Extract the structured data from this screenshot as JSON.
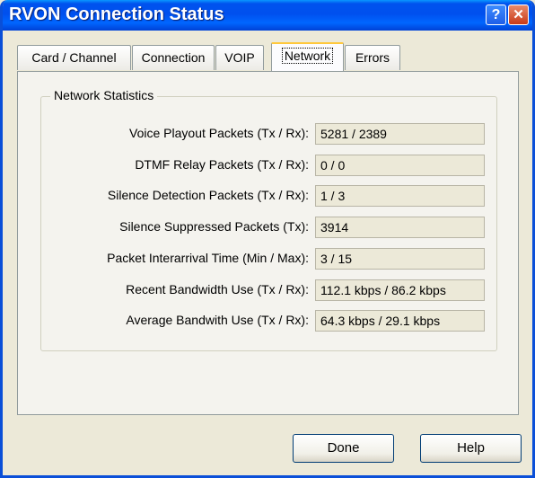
{
  "window": {
    "title": "RVON Connection Status",
    "help_glyph": "?",
    "close_glyph": "✕"
  },
  "tabs": [
    {
      "label": "Card / Channel",
      "active": false
    },
    {
      "label": "Connection",
      "active": false
    },
    {
      "label": "VOIP",
      "active": false
    },
    {
      "label": "Network",
      "active": true
    },
    {
      "label": "Errors",
      "active": false
    }
  ],
  "group": {
    "label": "Network Statistics",
    "rows": [
      {
        "label": "Voice Playout Packets (Tx / Rx):",
        "value": "5281 / 2389"
      },
      {
        "label": "DTMF Relay Packets (Tx / Rx):",
        "value": "0 / 0"
      },
      {
        "label": "Silence Detection Packets (Tx / Rx):",
        "value": "1 / 3"
      },
      {
        "label": "Silence Suppressed Packets (Tx):",
        "value": "3914"
      },
      {
        "label": "Packet Interarrival Time (Min / Max):",
        "value": "3 / 15"
      },
      {
        "label": "Recent Bandwidth Use (Tx / Rx):",
        "value": "112.1 kbps / 86.2 kbps"
      },
      {
        "label": "Average Bandwith Use (Tx / Rx):",
        "value": "64.3 kbps / 29.1 kbps"
      }
    ]
  },
  "buttons": {
    "done": "Done",
    "help": "Help"
  },
  "colors": {
    "titlebar": "#0053EE",
    "background": "#ECE9D8",
    "active_tab_accent": "#FFC83C"
  }
}
